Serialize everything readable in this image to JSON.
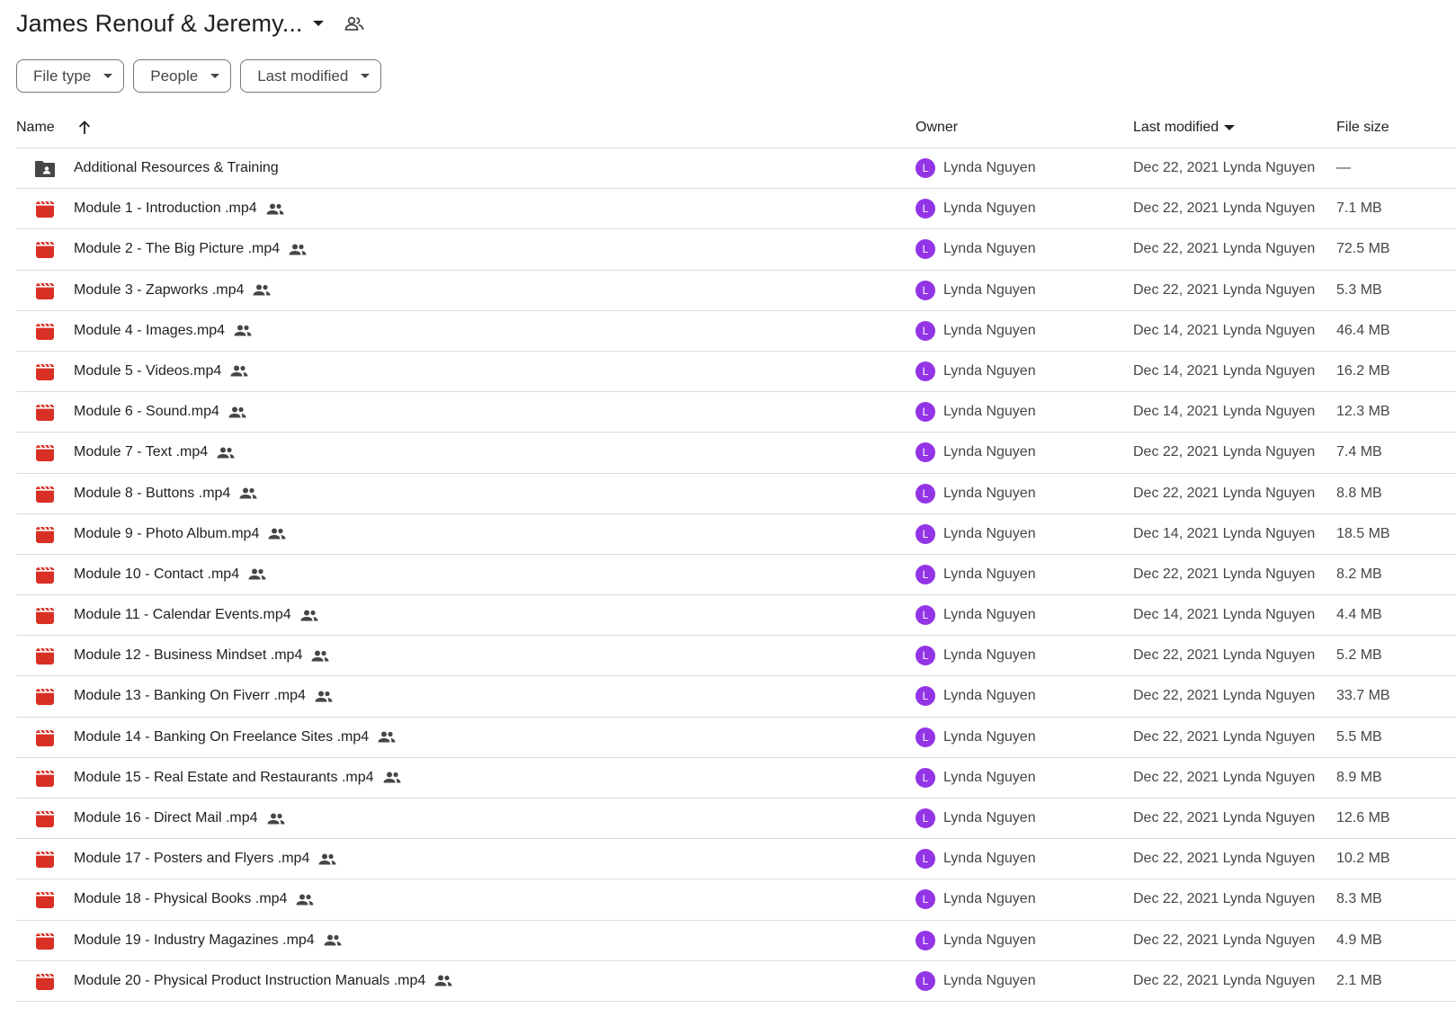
{
  "header": {
    "title": "James Renouf & Jeremy..."
  },
  "filters": [
    {
      "label": "File type"
    },
    {
      "label": "People"
    },
    {
      "label": "Last modified"
    }
  ],
  "columns": {
    "name": "Name",
    "owner": "Owner",
    "modified": "Last modified",
    "size": "File size"
  },
  "colors": {
    "video_icon": "#d93025",
    "folder_icon": "#444746",
    "avatar": "#9334e6"
  },
  "rows": [
    {
      "type": "folder",
      "name": "Additional Resources & Training",
      "shared": false,
      "avatar": "L",
      "owner": "Lynda Nguyen",
      "modified": "Dec 22, 2021 Lynda Nguyen",
      "size": "—"
    },
    {
      "type": "video",
      "name": "Module 1 - Introduction .mp4",
      "shared": true,
      "avatar": "L",
      "owner": "Lynda Nguyen",
      "modified": "Dec 22, 2021 Lynda Nguyen",
      "size": "7.1 MB"
    },
    {
      "type": "video",
      "name": "Module 2 - The Big Picture .mp4",
      "shared": true,
      "avatar": "L",
      "owner": "Lynda Nguyen",
      "modified": "Dec 22, 2021 Lynda Nguyen",
      "size": "72.5 MB"
    },
    {
      "type": "video",
      "name": "Module 3 - Zapworks .mp4",
      "shared": true,
      "avatar": "L",
      "owner": "Lynda Nguyen",
      "modified": "Dec 22, 2021 Lynda Nguyen",
      "size": "5.3 MB"
    },
    {
      "type": "video",
      "name": "Module 4 - Images.mp4",
      "shared": true,
      "avatar": "L",
      "owner": "Lynda Nguyen",
      "modified": "Dec 14, 2021 Lynda Nguyen",
      "size": "46.4 MB"
    },
    {
      "type": "video",
      "name": "Module 5 - Videos.mp4",
      "shared": true,
      "avatar": "L",
      "owner": "Lynda Nguyen",
      "modified": "Dec 14, 2021 Lynda Nguyen",
      "size": "16.2 MB"
    },
    {
      "type": "video",
      "name": "Module 6 - Sound.mp4",
      "shared": true,
      "avatar": "L",
      "owner": "Lynda Nguyen",
      "modified": "Dec 14, 2021 Lynda Nguyen",
      "size": "12.3 MB"
    },
    {
      "type": "video",
      "name": "Module 7 - Text .mp4",
      "shared": true,
      "avatar": "L",
      "owner": "Lynda Nguyen",
      "modified": "Dec 22, 2021 Lynda Nguyen",
      "size": "7.4 MB"
    },
    {
      "type": "video",
      "name": "Module 8 - Buttons .mp4",
      "shared": true,
      "avatar": "L",
      "owner": "Lynda Nguyen",
      "modified": "Dec 22, 2021 Lynda Nguyen",
      "size": "8.8 MB"
    },
    {
      "type": "video",
      "name": "Module 9 - Photo Album.mp4",
      "shared": true,
      "avatar": "L",
      "owner": "Lynda Nguyen",
      "modified": "Dec 14, 2021 Lynda Nguyen",
      "size": "18.5 MB"
    },
    {
      "type": "video",
      "name": "Module 10 - Contact .mp4",
      "shared": true,
      "avatar": "L",
      "owner": "Lynda Nguyen",
      "modified": "Dec 22, 2021 Lynda Nguyen",
      "size": "8.2 MB"
    },
    {
      "type": "video",
      "name": "Module 11 - Calendar Events.mp4",
      "shared": true,
      "avatar": "L",
      "owner": "Lynda Nguyen",
      "modified": "Dec 14, 2021 Lynda Nguyen",
      "size": "4.4 MB"
    },
    {
      "type": "video",
      "name": "Module 12 - Business Mindset .mp4",
      "shared": true,
      "avatar": "L",
      "owner": "Lynda Nguyen",
      "modified": "Dec 22, 2021 Lynda Nguyen",
      "size": "5.2 MB"
    },
    {
      "type": "video",
      "name": "Module 13 - Banking On Fiverr .mp4",
      "shared": true,
      "avatar": "L",
      "owner": "Lynda Nguyen",
      "modified": "Dec 22, 2021 Lynda Nguyen",
      "size": "33.7 MB"
    },
    {
      "type": "video",
      "name": "Module 14 - Banking On Freelance Sites .mp4",
      "shared": true,
      "avatar": "L",
      "owner": "Lynda Nguyen",
      "modified": "Dec 22, 2021 Lynda Nguyen",
      "size": "5.5 MB"
    },
    {
      "type": "video",
      "name": "Module 15 - Real Estate and Restaurants .mp4",
      "shared": true,
      "avatar": "L",
      "owner": "Lynda Nguyen",
      "modified": "Dec 22, 2021 Lynda Nguyen",
      "size": "8.9 MB"
    },
    {
      "type": "video",
      "name": "Module 16 - Direct Mail .mp4",
      "shared": true,
      "avatar": "L",
      "owner": "Lynda Nguyen",
      "modified": "Dec 22, 2021 Lynda Nguyen",
      "size": "12.6 MB"
    },
    {
      "type": "video",
      "name": "Module 17 - Posters and Flyers .mp4",
      "shared": true,
      "avatar": "L",
      "owner": "Lynda Nguyen",
      "modified": "Dec 22, 2021 Lynda Nguyen",
      "size": "10.2 MB"
    },
    {
      "type": "video",
      "name": "Module 18 - Physical Books .mp4",
      "shared": true,
      "avatar": "L",
      "owner": "Lynda Nguyen",
      "modified": "Dec 22, 2021 Lynda Nguyen",
      "size": "8.3 MB"
    },
    {
      "type": "video",
      "name": "Module 19 - Industry Magazines .mp4",
      "shared": true,
      "avatar": "L",
      "owner": "Lynda Nguyen",
      "modified": "Dec 22, 2021 Lynda Nguyen",
      "size": "4.9 MB"
    },
    {
      "type": "video",
      "name": "Module 20 - Physical Product Instruction Manuals .mp4",
      "shared": true,
      "avatar": "L",
      "owner": "Lynda Nguyen",
      "modified": "Dec 22, 2021 Lynda Nguyen",
      "size": "2.1 MB"
    }
  ]
}
